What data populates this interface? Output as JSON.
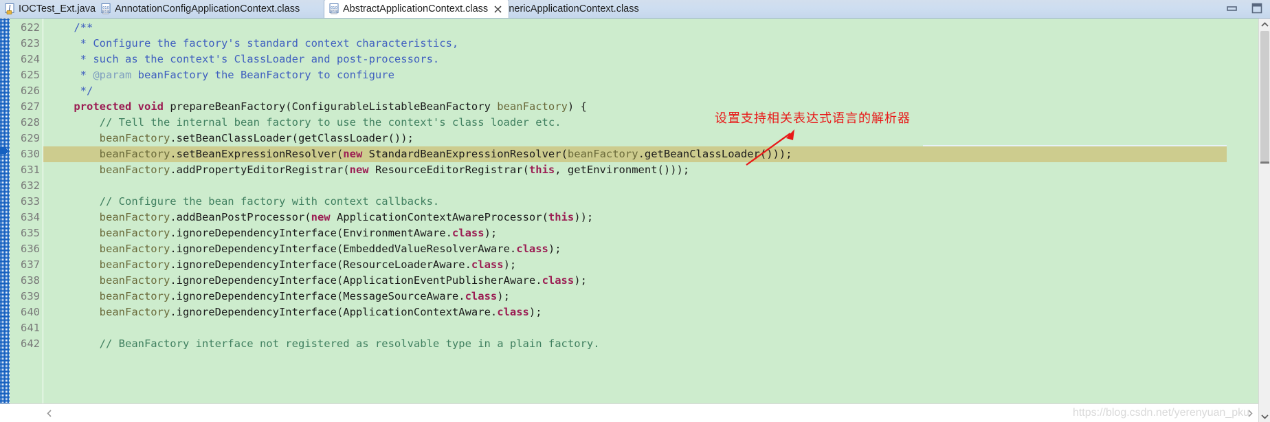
{
  "window": {
    "minimize_label": "Minimize",
    "maximize_label": "Maximize"
  },
  "tabs": [
    {
      "label": "IOCTest_Ext.java",
      "icon": "java-file-icon",
      "active": false,
      "closable": false
    },
    {
      "label": "AnnotationConfigApplicationContext.class",
      "icon": "class-file-icon",
      "active": false,
      "closable": false
    },
    {
      "label": "AbstractApplicationContext.class",
      "icon": "class-file-icon",
      "active": true,
      "closable": true
    },
    {
      "label": "GenericApplicationContext.class",
      "icon": "class-file-icon",
      "active": false,
      "closable": false
    }
  ],
  "editor": {
    "first_line": 622,
    "current_line": 630,
    "fold_lines": [
      622,
      627
    ],
    "lines": [
      {
        "num": "622",
        "fold": true,
        "tokens": [
          {
            "t": "    /**",
            "c": "t-jdoc"
          }
        ]
      },
      {
        "num": "623",
        "tokens": [
          {
            "t": "     * Configure the factory's standard context characteristics,",
            "c": "t-jdoc"
          }
        ]
      },
      {
        "num": "624",
        "tokens": [
          {
            "t": "     * such as the context's ClassLoader and post-processors.",
            "c": "t-jdoc"
          }
        ]
      },
      {
        "num": "625",
        "tokens": [
          {
            "t": "     * ",
            "c": "t-jdoc"
          },
          {
            "t": "@param",
            "c": "t-jdoctag"
          },
          {
            "t": " beanFactory the BeanFactory to configure",
            "c": "t-jdoc"
          }
        ]
      },
      {
        "num": "626",
        "tokens": [
          {
            "t": "     */",
            "c": "t-jdoc"
          }
        ]
      },
      {
        "num": "627",
        "fold": true,
        "tokens": [
          {
            "t": "    ",
            "c": "t-plain"
          },
          {
            "t": "protected",
            "c": "t-kw"
          },
          {
            "t": " ",
            "c": "t-plain"
          },
          {
            "t": "void",
            "c": "t-kw"
          },
          {
            "t": " prepareBeanFactory(ConfigurableListableBeanFactory ",
            "c": "t-plain"
          },
          {
            "t": "beanFactory",
            "c": "t-field"
          },
          {
            "t": ") {",
            "c": "t-plain"
          }
        ]
      },
      {
        "num": "628",
        "tokens": [
          {
            "t": "        // Tell the internal bean factory to use the context's class loader etc.",
            "c": "t-cmt"
          }
        ]
      },
      {
        "num": "629",
        "tokens": [
          {
            "t": "        ",
            "c": "t-plain"
          },
          {
            "t": "beanFactory",
            "c": "t-field"
          },
          {
            "t": ".setBeanClassLoader(getClassLoader());",
            "c": "t-plain"
          }
        ]
      },
      {
        "num": "630",
        "highlight": true,
        "tokens": [
          {
            "t": "        ",
            "c": "t-plain"
          },
          {
            "t": "beanFactory",
            "c": "t-field"
          },
          {
            "t": ".setBeanExpressionResolver(",
            "c": "t-plain"
          },
          {
            "t": "new",
            "c": "t-kw"
          },
          {
            "t": " StandardBeanExpressionResolver(",
            "c": "t-plain"
          },
          {
            "t": "beanFactory",
            "c": "t-field"
          },
          {
            "t": ".getBeanClassLoader()));",
            "c": "t-plain"
          }
        ]
      },
      {
        "num": "631",
        "tokens": [
          {
            "t": "        ",
            "c": "t-plain"
          },
          {
            "t": "beanFactory",
            "c": "t-field"
          },
          {
            "t": ".addPropertyEditorRegistrar(",
            "c": "t-plain"
          },
          {
            "t": "new",
            "c": "t-kw"
          },
          {
            "t": " ResourceEditorRegistrar(",
            "c": "t-plain"
          },
          {
            "t": "this",
            "c": "t-kw"
          },
          {
            "t": ", getEnvironment()));",
            "c": "t-plain"
          }
        ]
      },
      {
        "num": "632",
        "tokens": [
          {
            "t": "",
            "c": "t-plain"
          }
        ]
      },
      {
        "num": "633",
        "tokens": [
          {
            "t": "        // Configure the bean factory with context callbacks.",
            "c": "t-cmt"
          }
        ]
      },
      {
        "num": "634",
        "tokens": [
          {
            "t": "        ",
            "c": "t-plain"
          },
          {
            "t": "beanFactory",
            "c": "t-field"
          },
          {
            "t": ".addBeanPostProcessor(",
            "c": "t-plain"
          },
          {
            "t": "new",
            "c": "t-kw"
          },
          {
            "t": " ApplicationContextAwareProcessor(",
            "c": "t-plain"
          },
          {
            "t": "this",
            "c": "t-kw"
          },
          {
            "t": "));",
            "c": "t-plain"
          }
        ]
      },
      {
        "num": "635",
        "tokens": [
          {
            "t": "        ",
            "c": "t-plain"
          },
          {
            "t": "beanFactory",
            "c": "t-field"
          },
          {
            "t": ".ignoreDependencyInterface(EnvironmentAware.",
            "c": "t-plain"
          },
          {
            "t": "class",
            "c": "t-kw"
          },
          {
            "t": ");",
            "c": "t-plain"
          }
        ]
      },
      {
        "num": "636",
        "tokens": [
          {
            "t": "        ",
            "c": "t-plain"
          },
          {
            "t": "beanFactory",
            "c": "t-field"
          },
          {
            "t": ".ignoreDependencyInterface(EmbeddedValueResolverAware.",
            "c": "t-plain"
          },
          {
            "t": "class",
            "c": "t-kw"
          },
          {
            "t": ");",
            "c": "t-plain"
          }
        ]
      },
      {
        "num": "637",
        "tokens": [
          {
            "t": "        ",
            "c": "t-plain"
          },
          {
            "t": "beanFactory",
            "c": "t-field"
          },
          {
            "t": ".ignoreDependencyInterface(ResourceLoaderAware.",
            "c": "t-plain"
          },
          {
            "t": "class",
            "c": "t-kw"
          },
          {
            "t": ");",
            "c": "t-plain"
          }
        ]
      },
      {
        "num": "638",
        "tokens": [
          {
            "t": "        ",
            "c": "t-plain"
          },
          {
            "t": "beanFactory",
            "c": "t-field"
          },
          {
            "t": ".ignoreDependencyInterface(ApplicationEventPublisherAware.",
            "c": "t-plain"
          },
          {
            "t": "class",
            "c": "t-kw"
          },
          {
            "t": ");",
            "c": "t-plain"
          }
        ]
      },
      {
        "num": "639",
        "tokens": [
          {
            "t": "        ",
            "c": "t-plain"
          },
          {
            "t": "beanFactory",
            "c": "t-field"
          },
          {
            "t": ".ignoreDependencyInterface(MessageSourceAware.",
            "c": "t-plain"
          },
          {
            "t": "class",
            "c": "t-kw"
          },
          {
            "t": ");",
            "c": "t-plain"
          }
        ]
      },
      {
        "num": "640",
        "tokens": [
          {
            "t": "        ",
            "c": "t-plain"
          },
          {
            "t": "beanFactory",
            "c": "t-field"
          },
          {
            "t": ".ignoreDependencyInterface(ApplicationContextAware.",
            "c": "t-plain"
          },
          {
            "t": "class",
            "c": "t-kw"
          },
          {
            "t": ");",
            "c": "t-plain"
          }
        ]
      },
      {
        "num": "641",
        "tokens": [
          {
            "t": "",
            "c": "t-plain"
          }
        ]
      },
      {
        "num": "642",
        "tokens": [
          {
            "t": "        // BeanFactory interface not registered as resolvable type in a plain factory.",
            "c": "t-cmt"
          }
        ]
      }
    ]
  },
  "annotation": {
    "text": "设置支持相关表达式语言的解析器",
    "color": "#e81818"
  },
  "watermark": {
    "text": "https://blog.csdn.net/yerenyuan_pku"
  },
  "colors": {
    "editor_bg": "#cdeccd",
    "current_line_bg": "#cdcc8e",
    "tab_bar_bg": "#cdddf0",
    "javadoc": "#3f5fbf",
    "keyword": "#9b1d53",
    "comment": "#3f7f5f",
    "field": "#6a6a3a",
    "line_number": "#787878",
    "annotation_red": "#e81818"
  }
}
